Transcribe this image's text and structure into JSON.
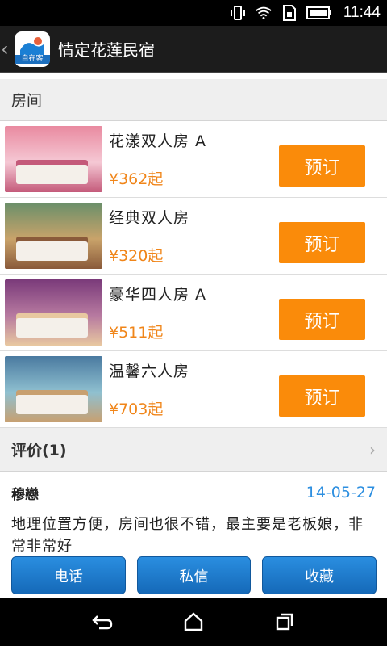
{
  "status": {
    "time": "11:44",
    "icons": [
      "vibrate-icon",
      "wifi-icon",
      "sim-icon",
      "battery-icon"
    ]
  },
  "app": {
    "title": "情定花莲民宿",
    "logo_text": "自在客",
    "back_icon": "chevron-left-icon"
  },
  "rooms_section": {
    "title": "房间"
  },
  "rooms": [
    {
      "name": "花漾双人房 A",
      "price": "¥362起",
      "button": "预订",
      "img_colors": [
        "#e98aa0",
        "#f5c8d4",
        "#c45a7a"
      ]
    },
    {
      "name": "经典双人房",
      "price": "¥320起",
      "button": "预订",
      "img_colors": [
        "#6a8f6a",
        "#c9a36a",
        "#8a5a3a"
      ]
    },
    {
      "name": "豪华四人房 A",
      "price": "¥511起",
      "button": "预订",
      "img_colors": [
        "#7a3a7a",
        "#b77aa0",
        "#e8c8a0"
      ]
    },
    {
      "name": "温馨六人房",
      "price": "¥703起",
      "button": "预订",
      "img_colors": [
        "#4a7aa0",
        "#8fc0d0",
        "#c8a070"
      ]
    }
  ],
  "reviews_section": {
    "title": "评价(1)",
    "chevron": "chevron-right-icon"
  },
  "review": {
    "author": "穆戀",
    "date": "14-05-27",
    "text": "地理位置方便，房间也很不错，最主要是老板娘，非常非常好"
  },
  "actions": {
    "call": "电话",
    "message": "私信",
    "favorite": "收藏"
  },
  "nav": [
    "back-icon",
    "home-icon",
    "recent-apps-icon"
  ],
  "colors": {
    "accent_orange": "#fa8b0a",
    "price_orange": "#f08519",
    "accent_blue": "#1b7fd4"
  }
}
